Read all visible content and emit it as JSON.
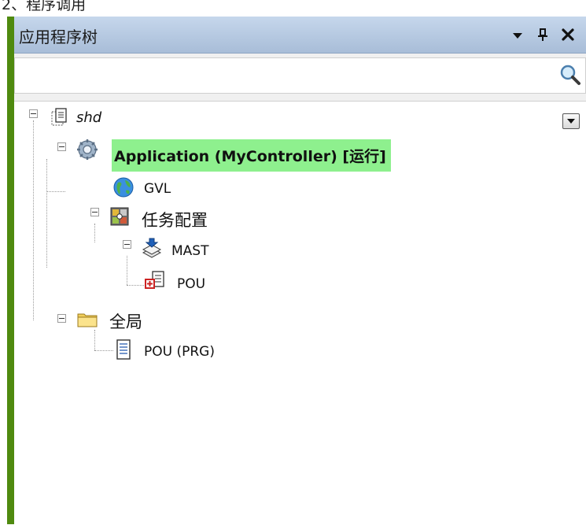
{
  "page": {
    "caption": "2、程序调用"
  },
  "panel": {
    "title": "应用程序树",
    "buttons": {
      "menu_icon": "chevron-down-icon",
      "pin_icon": "pin-icon",
      "close_icon": "close-icon"
    },
    "search": {
      "value": "",
      "placeholder": "",
      "icon": "search-icon"
    }
  },
  "tree": {
    "project": {
      "label": "shd",
      "icon": "project-icon",
      "expanded": true
    },
    "application": {
      "label": "Application (MyController) [运行]",
      "icon": "gear-icon",
      "highlight": "#8ef08e",
      "expanded": true
    },
    "gvl": {
      "label": "GVL",
      "icon": "globe-icon"
    },
    "task_config": {
      "label": "任务配置",
      "icon": "task-config-icon",
      "expanded": true
    },
    "mast": {
      "label": "MAST",
      "icon": "task-icon",
      "expanded": true
    },
    "mast_pou": {
      "label": "POU",
      "icon": "pou-call-icon"
    },
    "global": {
      "label": "全局",
      "icon": "folder-icon",
      "expanded": true
    },
    "global_pou": {
      "label": "POU (PRG)",
      "icon": "document-icon"
    }
  },
  "colors": {
    "accent_bar": "#4f8a0f",
    "title_bar": "#b6c9e2",
    "running_highlight": "#8ef08e"
  }
}
